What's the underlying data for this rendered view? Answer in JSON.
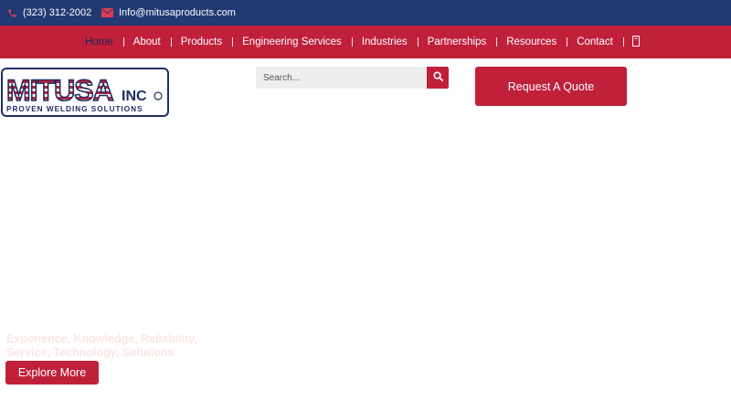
{
  "topbar": {
    "phone": "(323) 312-2002",
    "email": "Info@mitusaproducts.com",
    "phone_icon": "phone-icon",
    "email_icon": "envelope-icon"
  },
  "nav": {
    "items": [
      "Home",
      "About",
      "Products",
      "Engineering Services",
      "Industries",
      "Partnerships",
      "Resources",
      "Contact"
    ],
    "active": "Home",
    "cart_icon": "cart-icon"
  },
  "logo": {
    "name": "MITUSA",
    "suffix": "INC",
    "tagline": "PROVEN WELDING SOLUTIONS"
  },
  "search": {
    "placeholder": "Search...",
    "icon": "search-icon"
  },
  "quote_button": "Request A Quote",
  "hero": {
    "line1": "Experience, Knowledge, Reliability,",
    "line2": "Service, Technology, Solutions",
    "button": "Explore More"
  },
  "colors": {
    "navy": "#213a74",
    "red": "#c0203a",
    "hero_text": "#fde4e4"
  }
}
